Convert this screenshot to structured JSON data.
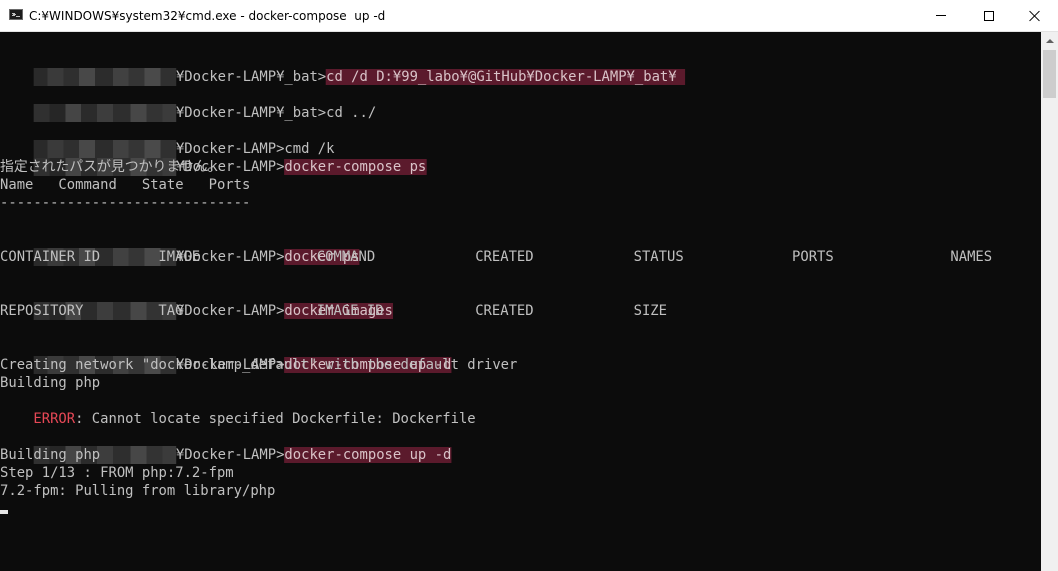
{
  "window": {
    "title": "C:¥WINDOWS¥system32¥cmd.exe - docker-compose  up -d",
    "minimize_icon": "minimize-icon",
    "maximize_icon": "maximize-icon",
    "close_icon": "close-icon"
  },
  "console": {
    "lines": {
      "l1": {
        "path": "¥Docker-LAMP¥_bat>",
        "cmd": "cd /d D:¥99_labo¥@GitHub¥Docker-LAMP¥_bat¥ "
      },
      "l2": {
        "path": "¥Docker-LAMP¥_bat>",
        "cmd": "cd ../"
      },
      "l3": {
        "path": "¥Docker-LAMP>",
        "cmd": "cmd /k"
      },
      "l4": {
        "path": "¥Docker-LAMP>",
        "cmd": "docker-compose ps"
      },
      "l5": {
        "text": "指定されたパスが見つかりません。"
      },
      "l6": {
        "text": "Name   Command   State   Ports"
      },
      "l7": {
        "text": "------------------------------"
      },
      "l8": {
        "path": "¥Docker-LAMP>",
        "cmd": "docker ps"
      },
      "l9": {
        "cols": [
          "CONTAINER ID",
          "IMAGE",
          "COMMAND",
          "CREATED",
          "STATUS",
          "PORTS",
          "NAMES"
        ]
      },
      "l10": {
        "path": "¥Docker-LAMP>",
        "cmd": "docker images"
      },
      "l11": {
        "cols": [
          "REPOSITORY",
          "TAG",
          "IMAGE ID",
          "CREATED",
          "SIZE"
        ]
      },
      "l12": {
        "path": "¥Docker-LAMP>",
        "cmd": "docker-compose up -d"
      },
      "l13": {
        "text": "Creating network \"docker-lamp_default\" with the default driver"
      },
      "l14": {
        "text": "Building php"
      },
      "l15": {
        "err": "ERROR",
        "text": ": Cannot locate specified Dockerfile: Dockerfile"
      },
      "l16": {
        "path": "¥Docker-LAMP>",
        "cmd": "docker-compose up -d"
      },
      "l17": {
        "text": "Building php"
      },
      "l18": {
        "text": "Step 1/13 : FROM php:7.2-fpm"
      },
      "l19": {
        "text": "7.2-fpm: Pulling from library/php"
      }
    }
  },
  "colors": {
    "console_bg": "#0c0c0c",
    "console_text": "#c0c0c0",
    "selection_highlight": "#5b1a2c",
    "error_text": "#e74856"
  }
}
